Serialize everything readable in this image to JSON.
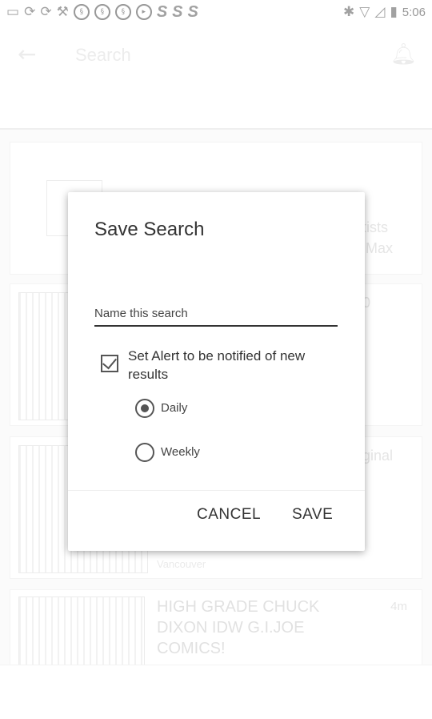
{
  "status_bar": {
    "left_icons": [
      "message-icon",
      "notification-icon",
      "notification-icon",
      "wrench-icon",
      "app-icon",
      "app-icon",
      "app-icon",
      "media-icon",
      "s-icon",
      "s-icon",
      "s-icon"
    ],
    "time": "5:06"
  },
  "app_bar": {
    "title": "Search"
  },
  "background_items": [
    {
      "title": "HIGH GRADE CHUCK DIXON IDW G.I.JOE COMICS!",
      "age": "4m"
    }
  ],
  "background_fragments": {
    "card1_right_1": "tists",
    "card1_right_2": "Max",
    "card2_right": "0",
    "card3_right": "ginal",
    "card3_location": "Vancouver"
  },
  "dialog": {
    "title": "Save Search",
    "name_placeholder": "Name this search",
    "name_value": "",
    "alert_checked": true,
    "alert_label": "Set Alert to be notified of new results",
    "frequency_options": [
      {
        "label": "Daily",
        "selected": true
      },
      {
        "label": "Weekly",
        "selected": false
      }
    ],
    "cancel_label": "CANCEL",
    "save_label": "SAVE"
  }
}
